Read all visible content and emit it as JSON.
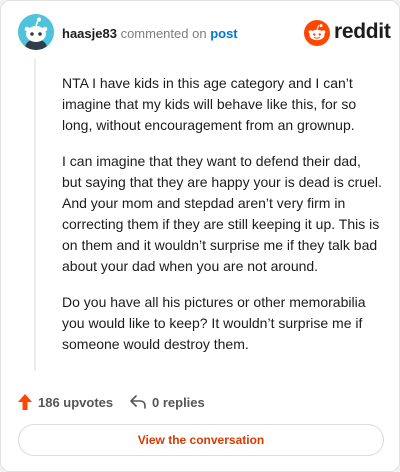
{
  "header": {
    "username": "haasje83",
    "action_text": "commented on",
    "post_link": "post",
    "brand": "reddit",
    "avatar_icon": "snoo-avatar-icon",
    "brand_icon": "reddit-logo-icon"
  },
  "comment": {
    "paragraphs": [
      "NTA I have kids in this age category and I can’t imagine that my kids will behave like this, for so long, without encouragement from an grownup.",
      "I can imagine that they want to defend their dad, but saying that they are happy your is dead is cruel. And your mom and stepdad aren’t very firm in correcting them if they are still keeping it up. This is on them and it wouldn’t surprise me if they talk bad about your dad when you are not around.",
      "Do you have all his pictures or other memorabilia you would like to keep? It wouldn’t surprise me if someone would destroy them."
    ]
  },
  "actions": {
    "upvotes": "186 upvotes",
    "replies": "0 replies",
    "upvote_icon": "upvote-arrow-icon",
    "reply_icon": "reply-arrow-icon"
  },
  "button": {
    "label": "View the conversation"
  },
  "colors": {
    "accent": "#ff4500",
    "link": "#0079d3",
    "button_text": "#d93a00",
    "avatar_bg": "#4fc3dc"
  }
}
